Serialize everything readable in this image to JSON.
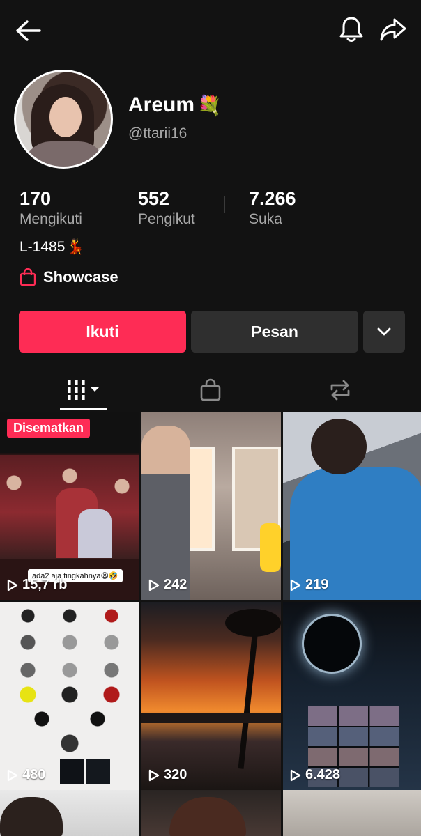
{
  "profile": {
    "name": "Areum",
    "name_emoji": "💐",
    "handle": "@ttarii16",
    "bio": "L-1485",
    "bio_emoji": "💃",
    "showcase_label": "Showcase"
  },
  "stats": [
    {
      "value": "170",
      "label": "Mengikuti"
    },
    {
      "value": "552",
      "label": "Pengikut"
    },
    {
      "value": "7.266",
      "label": "Suka"
    }
  ],
  "actions": {
    "follow_label": "Ikuti",
    "message_label": "Pesan"
  },
  "colors": {
    "accent": "#fe2c55",
    "background": "#121212",
    "secondary_button": "#2f2f2f",
    "muted_text": "#a8a8a8"
  },
  "tabs": [
    {
      "icon": "videos-grid-icon",
      "active": true
    },
    {
      "icon": "shopping-bag-icon",
      "active": false
    },
    {
      "icon": "repost-icon",
      "active": false
    }
  ],
  "videos": [
    {
      "views": "15,7 rb",
      "pinned_label": "Disematkan",
      "caption": "ada2 aja tingkahnya😫🤣"
    },
    {
      "views": "242"
    },
    {
      "views": "219"
    },
    {
      "views": "480"
    },
    {
      "views": "320"
    },
    {
      "views": "6.428"
    },
    {
      "views": ""
    },
    {
      "views": ""
    },
    {
      "views": ""
    }
  ]
}
